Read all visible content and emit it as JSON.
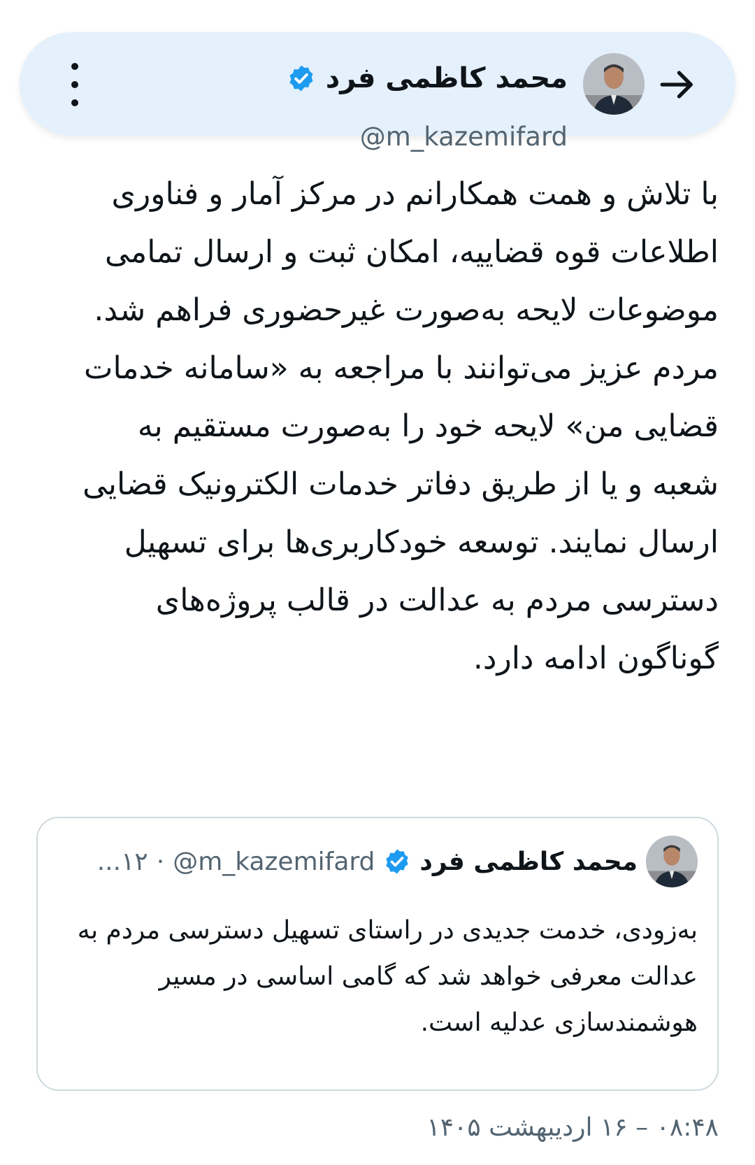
{
  "header": {
    "name": "محمد کاظمی فرد",
    "handle": "@m_kazemifard",
    "back_icon": "arrow-right-icon",
    "more_icon": "vertical-dots-icon",
    "verified_icon": "verified-badge-icon"
  },
  "tweet": {
    "text": "با تلاش و همت همکارانم در مرکز آمار و فناوری اطلاعات قوه قضاییه، امکان ثبت و ارسال تمامی موضوعات لایحه به‌صورت غیرحضوری فراهم شد. مردم عزیز می‌توانند با مراجعه به «سامانه خدمات قضایی من» لایحه خود را به‌صورت مستقیم به شعبه و یا از طریق دفاتر خدمات الکترونیک قضایی ارسال نمایند. توسعه خودکاربری‌ها برای تسهیل دسترسی مردم به عدالت در قالب پروژه‌های گوناگون ادامه دارد.",
    "timestamp": "۰۸:۴۸ – ۱۶ اردیبهشت ۱۴۰۵"
  },
  "quote": {
    "name": "محمد کاظمی فرد",
    "handle": "@m_kazemifard",
    "separator": "·",
    "time": "۱۲...",
    "text": "به‌زودی، خدمت جدیدی در راستای تسهیل دسترسی مردم به عدالت معرفی خواهد شد که گامی اساسی در مسیر هوشمندسازی عدلیه است."
  },
  "colors": {
    "header_bg": "#e4f0fb",
    "verified": "#1d9bf0",
    "text": "#0f1419",
    "muted": "#536471",
    "border": "#cfd9de"
  }
}
